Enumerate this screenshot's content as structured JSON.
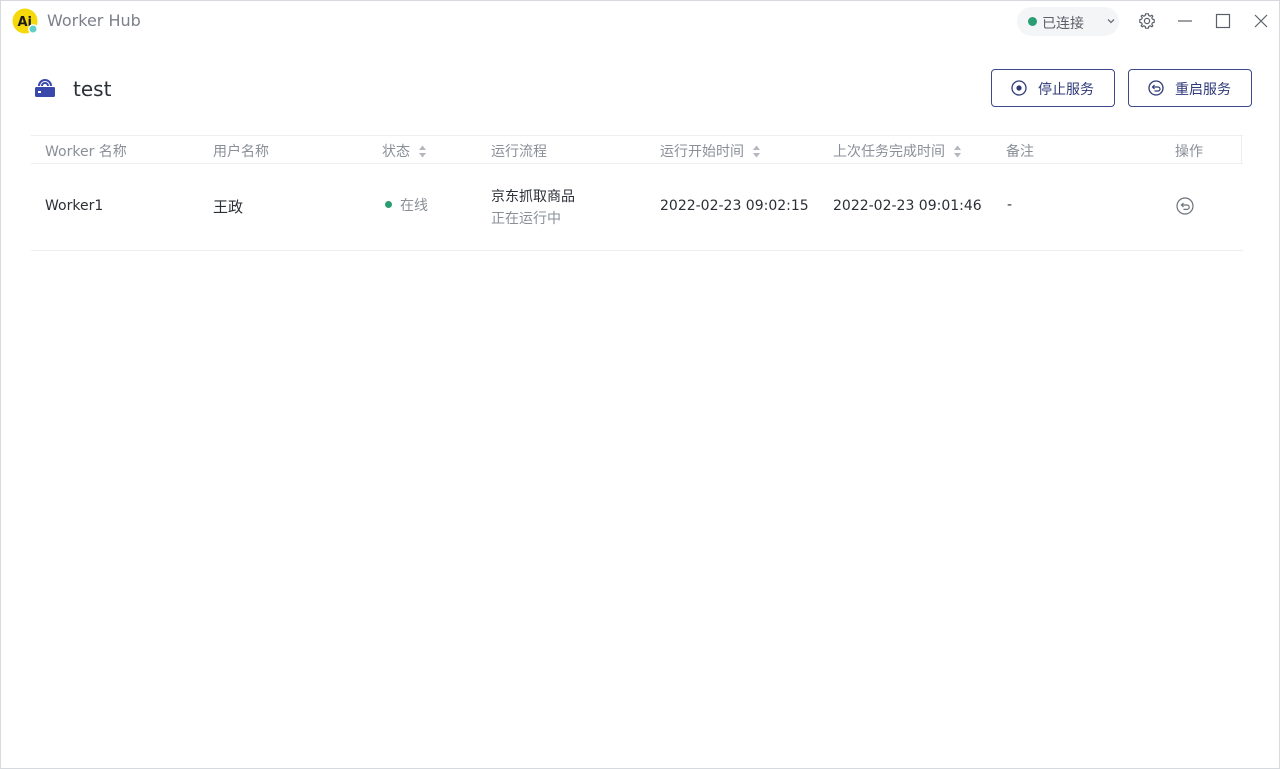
{
  "app": {
    "logo_text": "Ai",
    "title": "Worker Hub"
  },
  "connection": {
    "label": "已连接",
    "color": "#2a9d72"
  },
  "colors": {
    "accent": "#3c4a8c",
    "online": "#2a9d72",
    "logo_bg": "#f5d90a"
  },
  "icons": {
    "settings": "gear-icon",
    "minimize": "minimize-icon",
    "maximize": "maximize-icon",
    "close": "close-icon",
    "hub": "worker-hub-icon",
    "stop": "stop-circle-icon",
    "restart": "restart-circle-icon",
    "row_action": "restart-circle-icon"
  },
  "header": {
    "title": "test",
    "stop_label": "停止服务",
    "restart_label": "重启服务"
  },
  "table": {
    "columns": [
      {
        "label": "Worker 名称",
        "sortable": false
      },
      {
        "label": "用户名称",
        "sortable": false
      },
      {
        "label": "状态",
        "sortable": true
      },
      {
        "label": "运行流程",
        "sortable": false
      },
      {
        "label": "运行开始时间",
        "sortable": true
      },
      {
        "label": "上次任务完成时间",
        "sortable": true
      },
      {
        "label": "备注",
        "sortable": false
      },
      {
        "label": "操作",
        "sortable": false
      }
    ],
    "rows": [
      {
        "worker": "Worker1",
        "user": "王政",
        "status": "在线",
        "flow_name": "京东抓取商品",
        "flow_state": "正在运行中",
        "start_time": "2022-02-23 09:02:15",
        "last_done": "2022-02-23 09:01:46",
        "note": "-"
      }
    ]
  }
}
